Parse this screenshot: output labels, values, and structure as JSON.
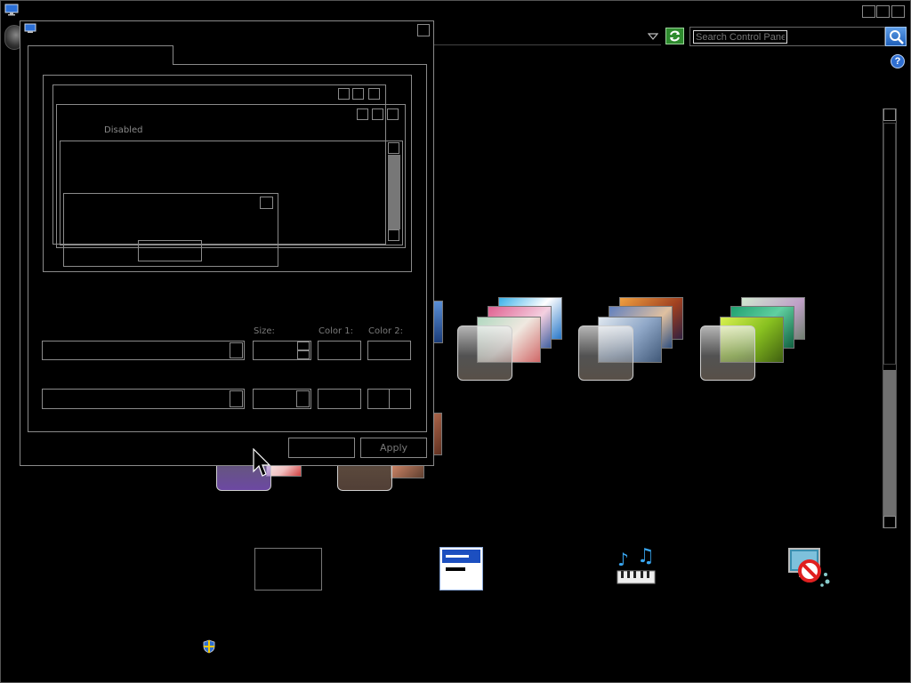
{
  "search": {
    "placeholder": "Search Control Panel"
  },
  "dialog": {
    "preview": {
      "disabled_label": "Disabled"
    },
    "fields": {
      "size_label": "Size:",
      "color1_label": "Color 1:",
      "color2_label": "Color 2:"
    },
    "buttons": {
      "ok_label": "",
      "apply_label": "Apply"
    }
  },
  "icons": {
    "app": "monitor-icon",
    "back": "back-arrow-icon",
    "refresh": "refresh-icon",
    "search": "search-icon",
    "help": "help-icon",
    "dropdown": "chevron-down-icon",
    "shield": "uac-shield-icon",
    "desktop_background": "desktop-background-icon",
    "window_color": "window-color-icon",
    "sounds": "sounds-icon",
    "screen_saver": "screen-saver-icon"
  },
  "colors": {
    "background": "#000000",
    "outline": "#8a8a8a",
    "search_accent": "#3a7bd5",
    "help_accent": "#2f6fd1"
  }
}
